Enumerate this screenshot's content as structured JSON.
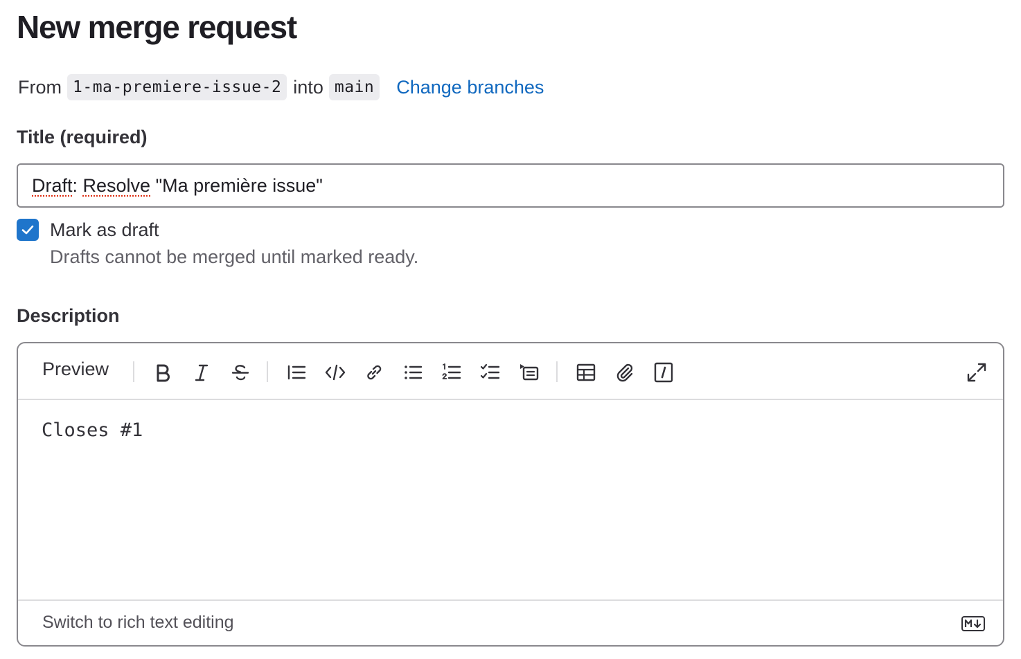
{
  "page": {
    "title": "New merge request"
  },
  "branches": {
    "from_label": "From",
    "source": "1-ma-premiere-issue-2",
    "into_label": "into",
    "target": "main",
    "change_link": "Change branches"
  },
  "title_field": {
    "label": "Title (required)",
    "value_part1": "Draft",
    "value_part2": ": ",
    "value_part3": "Resolve",
    "value_part4": " \"Ma première issue\""
  },
  "draft": {
    "checked": true,
    "label": "Mark as draft",
    "help": "Drafts cannot be merged until marked ready."
  },
  "description": {
    "label": "Description",
    "toolbar": {
      "preview_label": "Preview",
      "icons": [
        "bold-icon",
        "italic-icon",
        "strikethrough-icon",
        "quote-icon",
        "code-icon",
        "link-icon",
        "bullet-list-icon",
        "numbered-list-icon",
        "task-list-icon",
        "collapsible-section-icon",
        "table-icon",
        "attach-file-icon",
        "quick-actions-icon",
        "fullscreen-icon"
      ]
    },
    "content": "Closes #1",
    "footer": {
      "switch_label": "Switch to rich text editing",
      "markdown_icon": "markdown-icon"
    }
  },
  "colors": {
    "accent": "#1f75cb",
    "link": "#1068bf",
    "border": "#89888d"
  }
}
